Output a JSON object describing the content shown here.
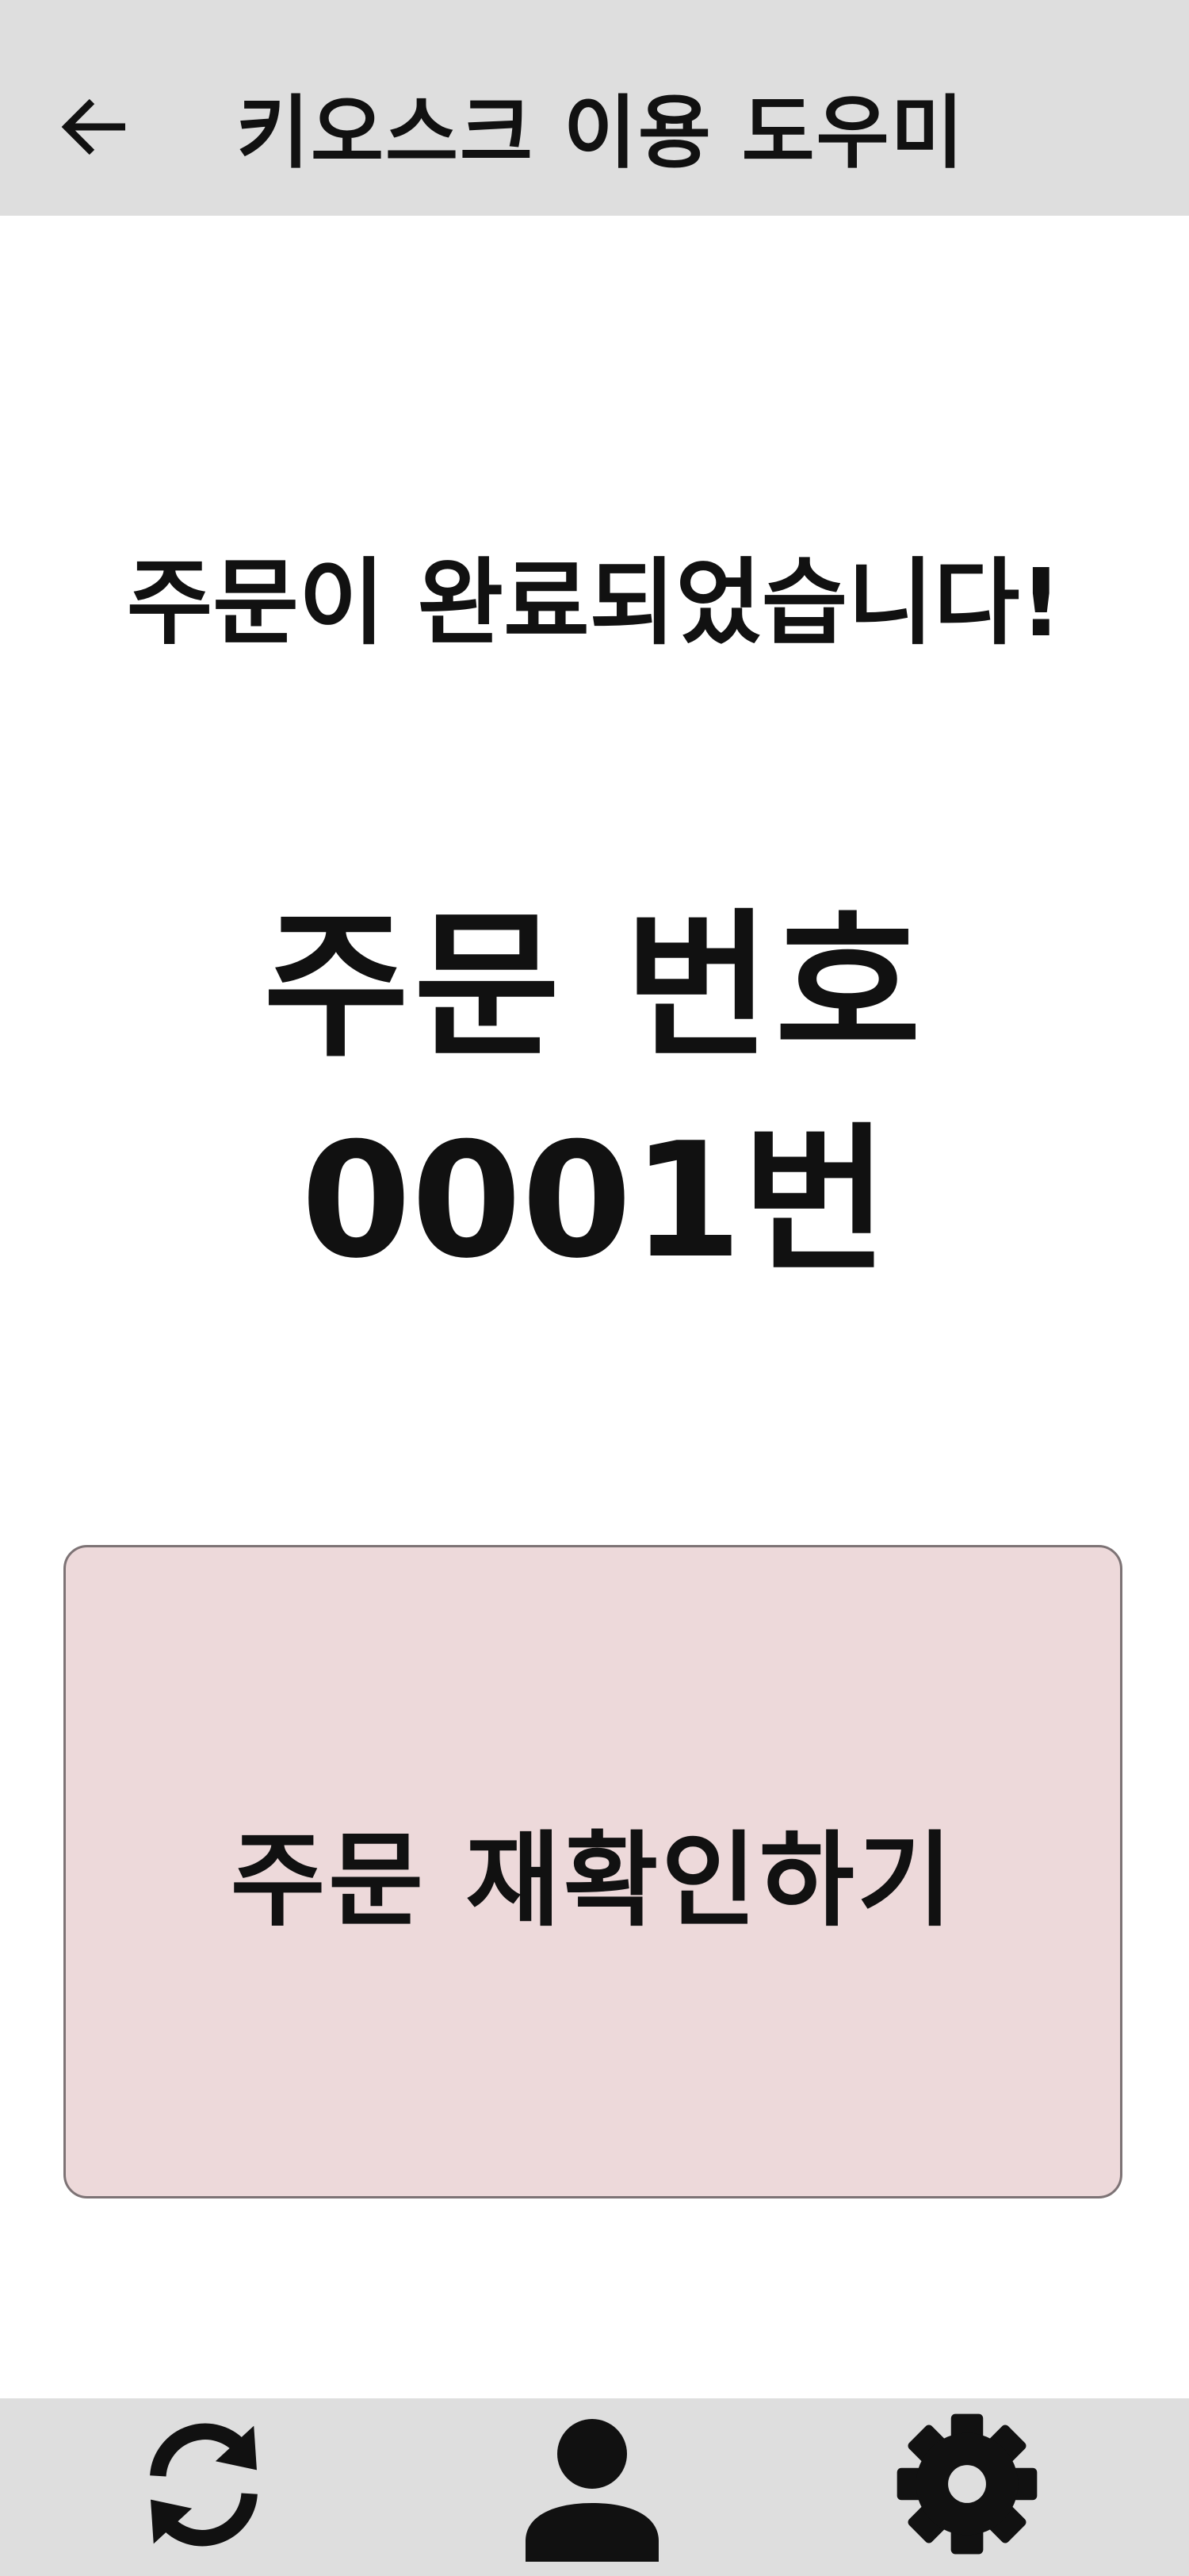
{
  "header": {
    "back_icon": "arrow-left-icon",
    "title": "키오스크 이용 도우미"
  },
  "main": {
    "complete_message": "주문이 완료되었습니다!",
    "order_number_label": "주문 번호",
    "order_number_value": "0001번",
    "recheck_button_label": "주문 재확인하기"
  },
  "bottom_nav": {
    "items": [
      {
        "icon": "refresh-icon"
      },
      {
        "icon": "user-icon"
      },
      {
        "icon": "gear-icon"
      }
    ]
  },
  "colors": {
    "bar_background": "#dedede",
    "button_background": "#edd9da",
    "button_border": "#7d7375",
    "text": "#111111"
  }
}
